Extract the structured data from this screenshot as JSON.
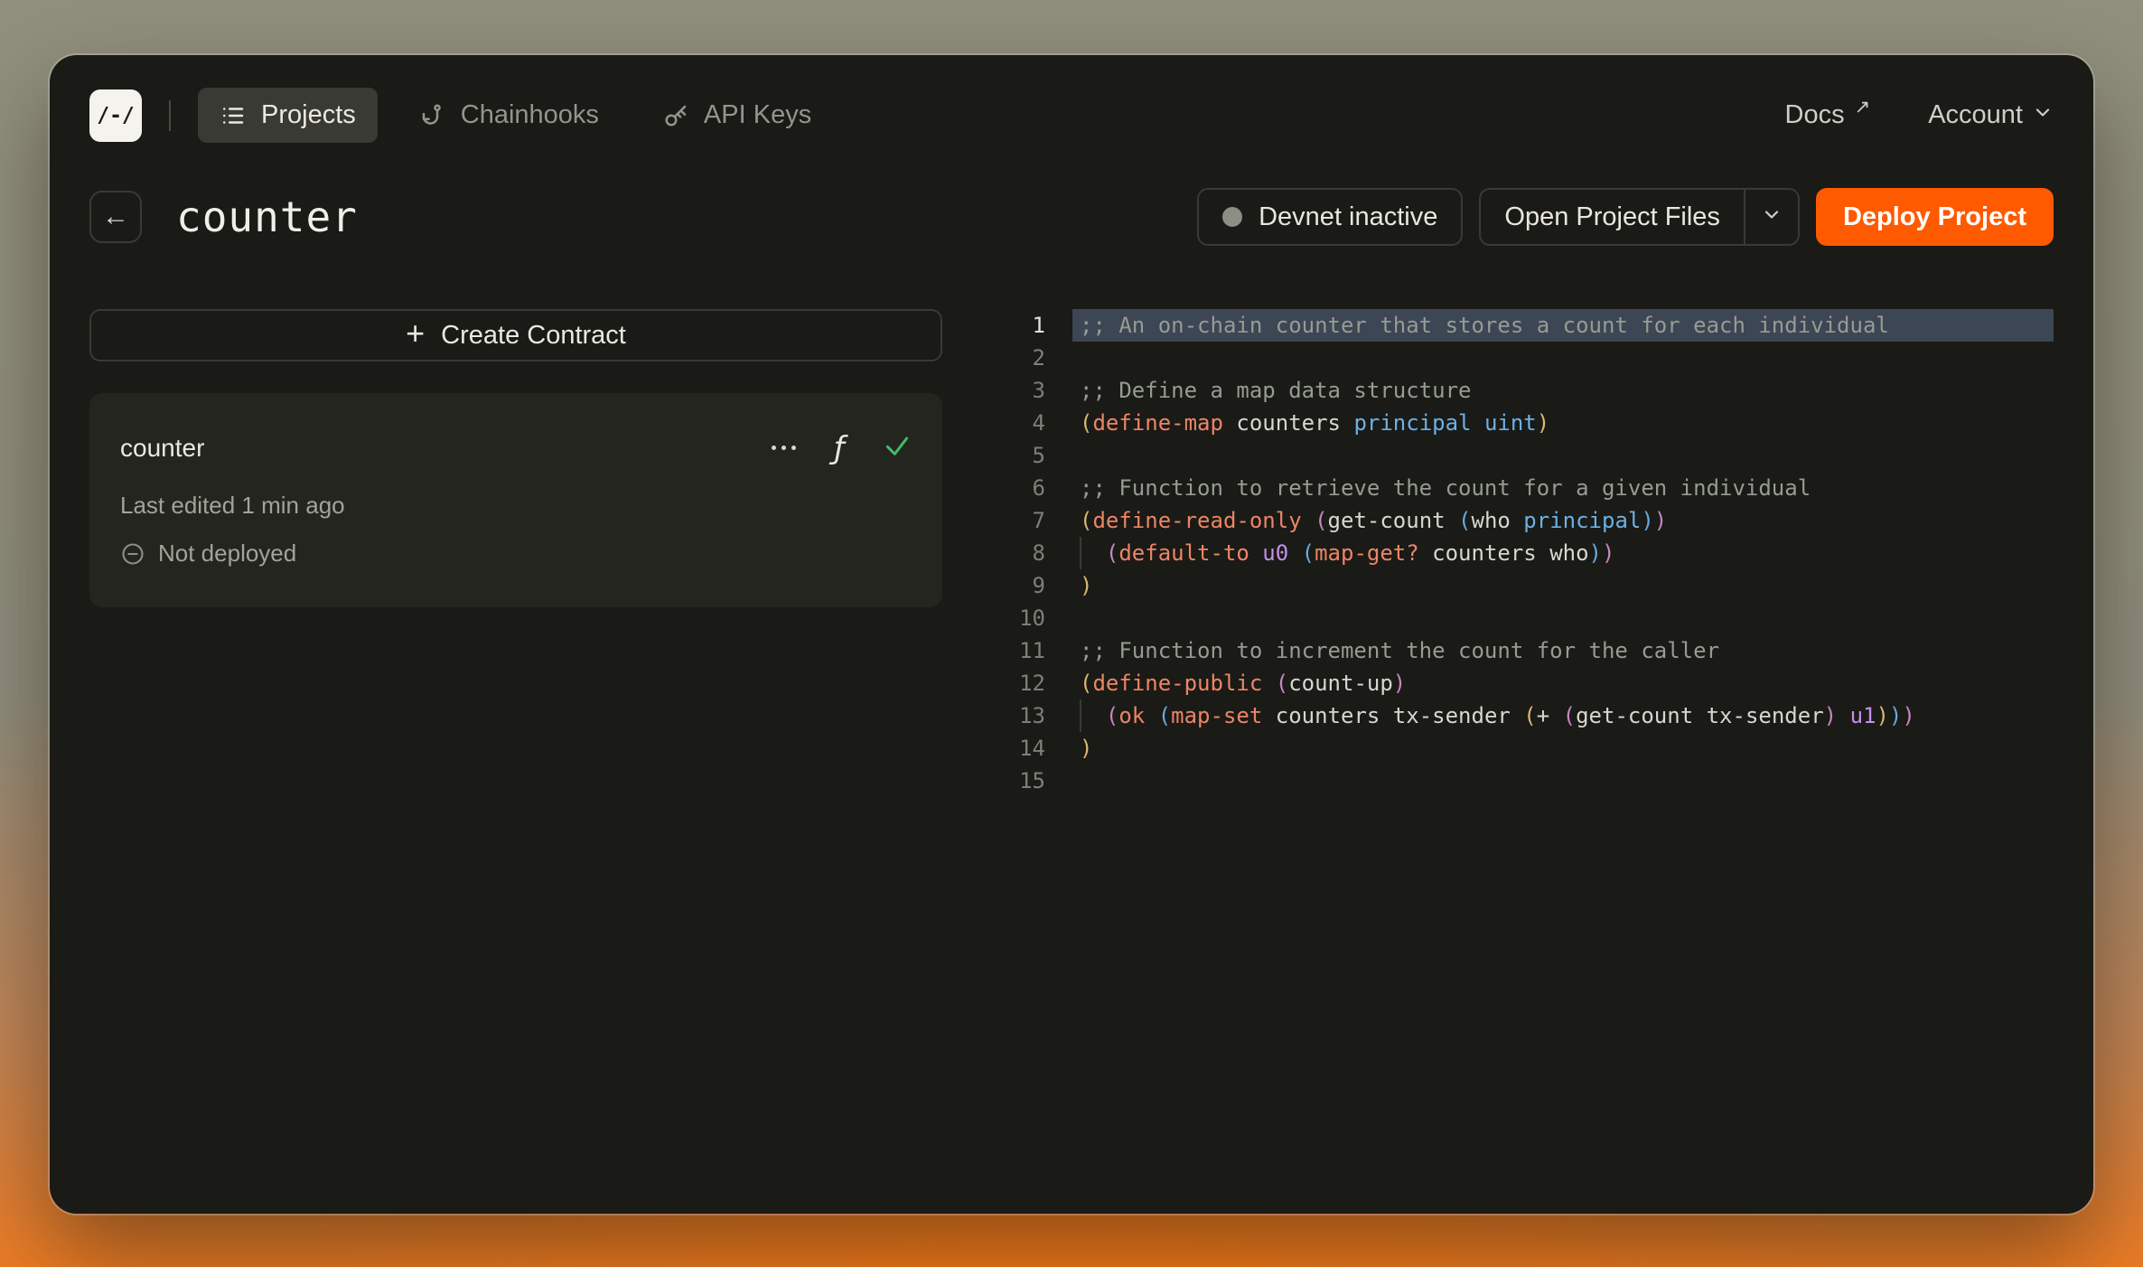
{
  "colors": {
    "accent_orange": "#FF5A00",
    "success_green": "#43BE64",
    "window_bg": "#1A1A17",
    "card_bg": "#25251F",
    "line_highlight_bg": "#3D4654"
  },
  "topnav": {
    "logo": "/-/",
    "tabs": [
      {
        "label": "Projects",
        "icon": "list-icon",
        "active": true
      },
      {
        "label": "Chainhooks",
        "icon": "chainhook-icon",
        "active": false
      },
      {
        "label": "API Keys",
        "icon": "key-icon",
        "active": false
      }
    ],
    "docs_label": "Docs",
    "docs_arrow": "↗",
    "account_label": "Account"
  },
  "header": {
    "title": "counter",
    "devnet_status": "Devnet inactive",
    "open_project_files": "Open Project Files",
    "deploy_project": "Deploy Project"
  },
  "sidebar": {
    "create_contract": "Create Contract",
    "plus": "+",
    "contract": {
      "name": "counter",
      "last_edited": "Last edited 1 min ago",
      "deploy_status": "Not deployed"
    }
  },
  "editor": {
    "active_line": 1,
    "lines": [
      {
        "n": 1,
        "hl": true,
        "tokens": [
          [
            "c",
            ";; An on-chain counter that stores a count for each individual"
          ]
        ]
      },
      {
        "n": 2,
        "tokens": []
      },
      {
        "n": 3,
        "tokens": [
          [
            "c",
            ";; Define a map data structure"
          ]
        ]
      },
      {
        "n": 4,
        "tokens": [
          [
            "p1",
            "("
          ],
          [
            "k",
            "define-map"
          ],
          [
            "w",
            " counters "
          ],
          [
            "t",
            "principal"
          ],
          [
            "w",
            " "
          ],
          [
            "t",
            "uint"
          ],
          [
            "p1",
            ")"
          ]
        ]
      },
      {
        "n": 5,
        "tokens": []
      },
      {
        "n": 6,
        "tokens": [
          [
            "c",
            ";; Function to retrieve the count for a given individual"
          ]
        ]
      },
      {
        "n": 7,
        "tokens": [
          [
            "p1",
            "("
          ],
          [
            "k",
            "define-read-only"
          ],
          [
            "w",
            " "
          ],
          [
            "p2",
            "("
          ],
          [
            "w",
            "get-count "
          ],
          [
            "p3",
            "("
          ],
          [
            "w",
            "who "
          ],
          [
            "t",
            "principal"
          ],
          [
            "p3",
            ")"
          ],
          [
            "p2",
            ")"
          ]
        ]
      },
      {
        "n": 8,
        "tokens": [
          [
            "g",
            "  "
          ],
          [
            "p2",
            "("
          ],
          [
            "k",
            "default-to"
          ],
          [
            "w",
            " "
          ],
          [
            "n",
            "u0"
          ],
          [
            "w",
            " "
          ],
          [
            "p3",
            "("
          ],
          [
            "k",
            "map-get?"
          ],
          [
            "w",
            " counters who"
          ],
          [
            "p3",
            ")"
          ],
          [
            "p2",
            ")"
          ]
        ]
      },
      {
        "n": 9,
        "tokens": [
          [
            "p1",
            ")"
          ]
        ]
      },
      {
        "n": 10,
        "tokens": []
      },
      {
        "n": 11,
        "tokens": [
          [
            "c",
            ";; Function to increment the count for the caller"
          ]
        ]
      },
      {
        "n": 12,
        "tokens": [
          [
            "p1",
            "("
          ],
          [
            "k",
            "define-public"
          ],
          [
            "w",
            " "
          ],
          [
            "p2",
            "("
          ],
          [
            "w",
            "count-up"
          ],
          [
            "p2",
            ")"
          ]
        ]
      },
      {
        "n": 13,
        "tokens": [
          [
            "g",
            "  "
          ],
          [
            "p2",
            "("
          ],
          [
            "k",
            "ok"
          ],
          [
            "w",
            " "
          ],
          [
            "p3",
            "("
          ],
          [
            "k",
            "map-set"
          ],
          [
            "w",
            " counters tx-sender "
          ],
          [
            "p1",
            "("
          ],
          [
            "w",
            "+ "
          ],
          [
            "p2",
            "("
          ],
          [
            "w",
            "get-count tx-sender"
          ],
          [
            "p2",
            ")"
          ],
          [
            "w",
            " "
          ],
          [
            "n",
            "u1"
          ],
          [
            "p1",
            ")"
          ],
          [
            "p3",
            ")"
          ],
          [
            "p2",
            ")"
          ]
        ]
      },
      {
        "n": 14,
        "tokens": [
          [
            "p1",
            ")"
          ]
        ]
      },
      {
        "n": 15,
        "tokens": []
      }
    ]
  }
}
